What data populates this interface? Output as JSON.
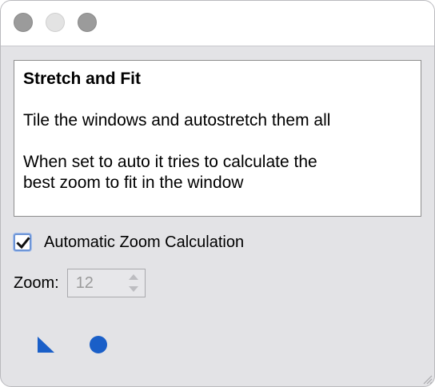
{
  "window": {
    "controls": [
      "close-button",
      "minimize-button",
      "maximize-button"
    ]
  },
  "description": {
    "title": "Stretch and Fit",
    "line1": "Tile the windows and autostretch them all",
    "line2a": "When set to auto it tries to calculate the",
    "line2b": "best zoom to fit in the window"
  },
  "auto_zoom": {
    "label": "Automatic Zoom Calculation",
    "checked": true
  },
  "zoom": {
    "label": "Zoom:",
    "value": "12"
  },
  "colors": {
    "accent": "#1a5fc8",
    "checkbox_border": "#6e95d6"
  },
  "icons": {
    "bottom_left": "triangle-corner-icon",
    "bottom_right": "circle-icon",
    "resize": "resize-grip-icon"
  }
}
